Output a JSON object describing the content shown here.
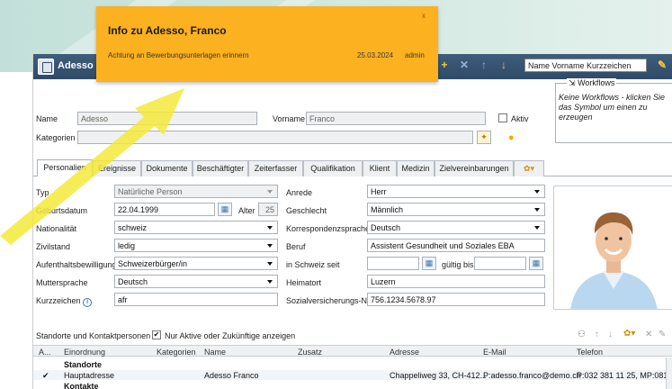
{
  "window": {
    "title": "Adesso F"
  },
  "toolbar": {
    "search_value": "Name Vorname Kurzzeichen"
  },
  "popup": {
    "title": "Info zu Adesso, Franco",
    "message": "Achtung an Bewerbungsunterlagen erinnern",
    "date": "25.03.2024",
    "user": "admin",
    "close": "x"
  },
  "header": {
    "name_label": "Name",
    "name_value": "Adesso",
    "vorname_label": "Vorname",
    "vorname_value": "Franco",
    "aktiv_label": "Aktiv",
    "kategorien_label": "Kategorien",
    "kategorien_value": ""
  },
  "workflows": {
    "legend": "Workflows",
    "text": "Keine Workflows - klicken Sie das Symbol um einen zu erzeugen"
  },
  "tabs": [
    {
      "label": "Personalien"
    },
    {
      "label": "Ereignisse"
    },
    {
      "label": "Dokumente"
    },
    {
      "label": "Beschäftigter"
    },
    {
      "label": "Zeiterfasser"
    },
    {
      "label": "Qualifikation"
    },
    {
      "label": "Klient"
    },
    {
      "label": "Medizin"
    },
    {
      "label": "Zielvereinbarungen"
    }
  ],
  "form": {
    "typ_label": "Typ",
    "typ_value": "Natürliche Person",
    "geburtsdatum_label": "Geburtsdatum",
    "geburtsdatum_value": "22.04.1999",
    "alter_label": "Alter",
    "alter_value": "25",
    "nationalitaet_label": "Nationalität",
    "nationalitaet_value": "schweiz",
    "zivilstand_label": "Zivilstand",
    "zivilstand_value": "ledig",
    "aufenthalt_label": "Aufenthaltsbewilligung",
    "aufenthalt_value": "Schweizerbürger/in",
    "mutter_label": "Muttersprache",
    "mutter_value": "Deutsch",
    "kurz_label": "Kurzzeichen",
    "kurz_value": "afr",
    "anrede_label": "Anrede",
    "anrede_value": "Herr",
    "geschlecht_label": "Geschlecht",
    "geschlecht_value": "Männlich",
    "korr_label": "Korrespondenzsprache",
    "korr_value": "Deutsch",
    "beruf_label": "Beruf",
    "beruf_value": "Assistent Gesundheit und Soziales EBA",
    "inschweiz_label": "in Schweiz seit",
    "inschweiz_value": "",
    "gueltig_label": "gültig bis",
    "gueltig_value": "",
    "heimat_label": "Heimatort",
    "heimat_value": "Luzern",
    "sozial_label": "Sozialversicherungs-Nr",
    "sozial_value": "756.1234.5678.97"
  },
  "contacts": {
    "section_label": "Standorte und Kontaktpersonen",
    "filter_label": "Nur Aktive oder Zukünftige anzeigen",
    "columns": [
      "A...",
      "Einordnung",
      "Kategorien",
      "Name",
      "Zusatz",
      "Adresse",
      "E-Mail",
      "Telefon"
    ],
    "group1": "Standorte",
    "row1": {
      "check": "✔",
      "einordnung": "Hauptadresse",
      "name": "Adesso Franco",
      "adresse": "Chappeliweg 33, CH-412...",
      "email": "P:adesso.franco@demo.ch",
      "telefon": "P:032 381 11 25, MP:081 ..."
    },
    "group2": "Kontakte"
  },
  "colors": {
    "accent": "#fbb120",
    "titlebar": "#2e4a66",
    "highlight": "#f5e93a"
  }
}
